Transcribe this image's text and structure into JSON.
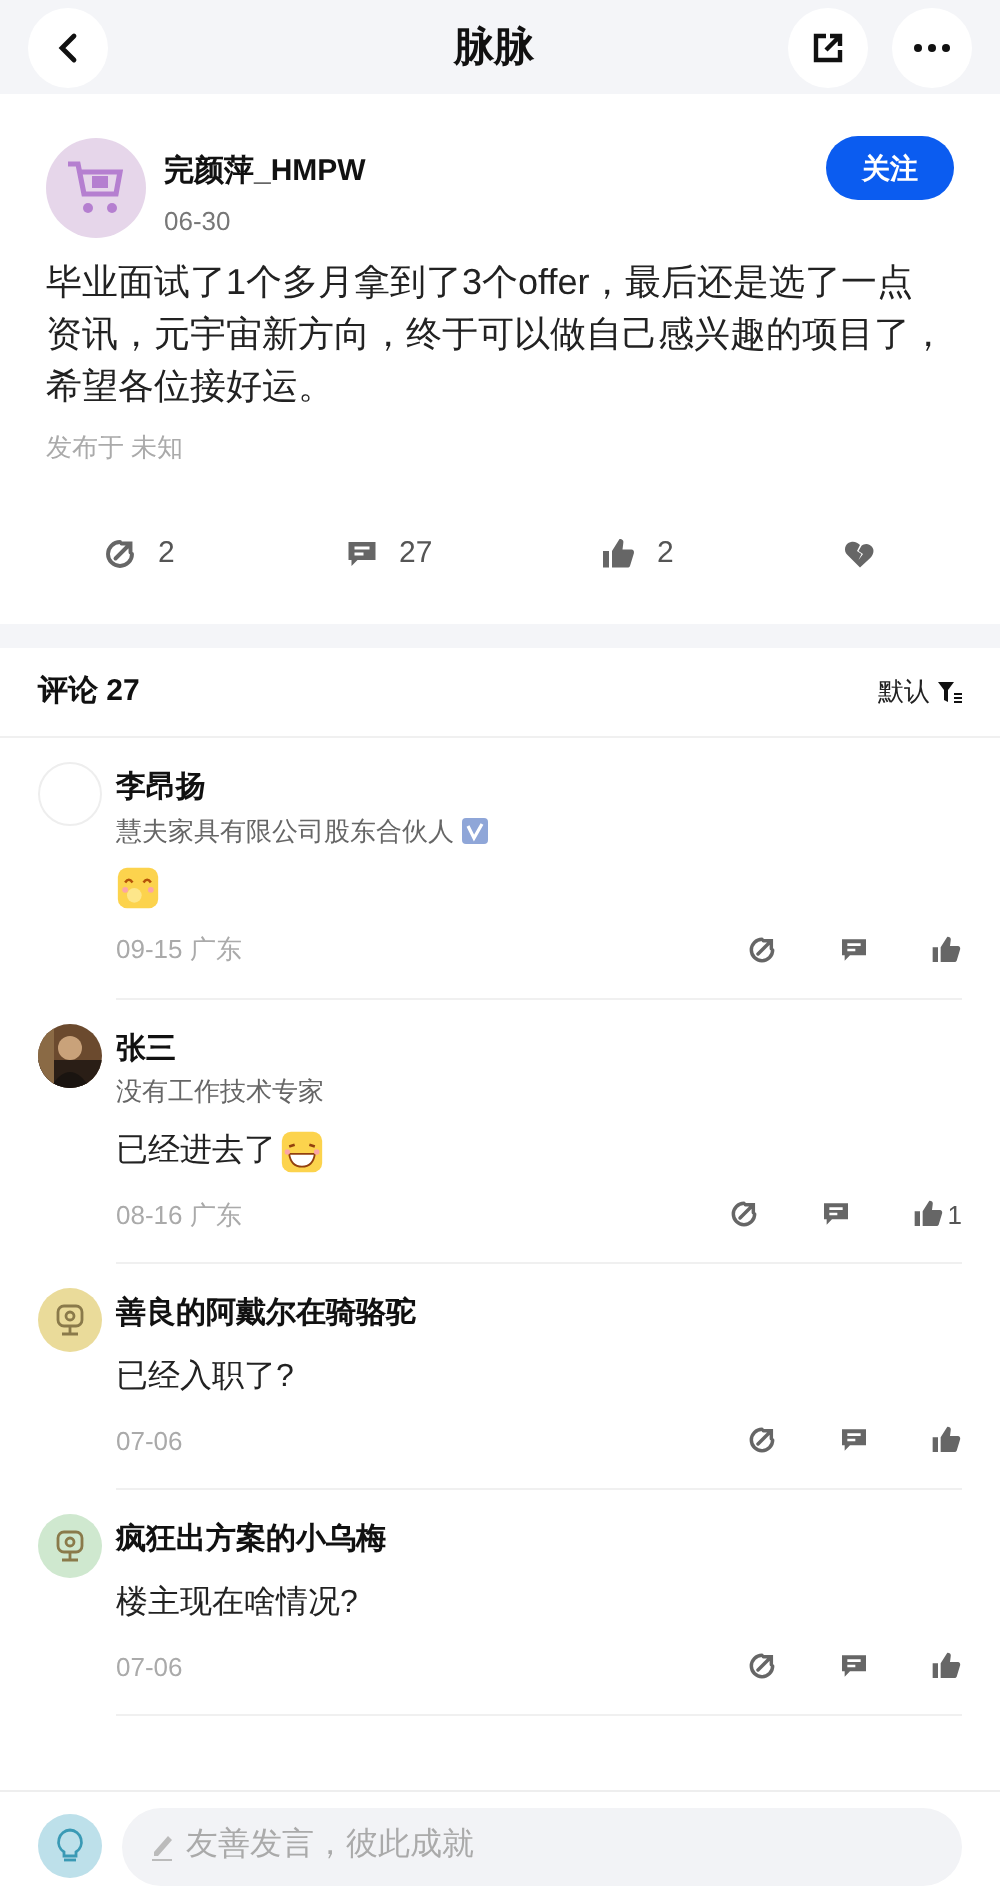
{
  "header": {
    "title": "脉脉"
  },
  "post": {
    "author": "完颜萍_HMPW",
    "date": "06-30",
    "follow": "关注",
    "body": "毕业面试了1个多月拿到了3个offer，最后还是选了一点资讯，元宇宙新方向，终于可以做自己感兴趣的项目了，希望各位接好运。",
    "published": "发布于 未知",
    "actions": [
      {
        "kind": "share",
        "count": "2"
      },
      {
        "kind": "comment",
        "count": "27"
      },
      {
        "kind": "like",
        "count": "2"
      },
      {
        "kind": "dislike"
      }
    ]
  },
  "comments_header": {
    "title": "评论 27",
    "sort": "默认"
  },
  "comments": [
    {
      "avatar": {
        "kind": "blank"
      },
      "name": "李昂扬",
      "subtitle": "慧夫家具有限公司股东合伙人",
      "verified": true,
      "emoji": {
        "kind": "smile"
      },
      "meta": "09-15 广东"
    },
    {
      "name": "张三",
      "subtitle": "没有工作技术专家",
      "verified": false,
      "text": "已经进去了",
      "emoji": {
        "kind": "grin"
      },
      "meta": "08-16 广东",
      "likes": "1"
    },
    {
      "avatar": {
        "kind": "icon",
        "color": "#eadb9a"
      },
      "name": "善良的阿戴尔在骑骆驼",
      "text": "已经入职了?",
      "meta": "07-06"
    },
    {
      "avatar": {
        "kind": "icon",
        "color": "#cfe8cf"
      },
      "name": "疯狂出方案的小乌梅",
      "text": "楼主现在啥情况?",
      "meta": "07-06"
    }
  ],
  "composer": {
    "placeholder": "友善发言，彼此成就"
  }
}
